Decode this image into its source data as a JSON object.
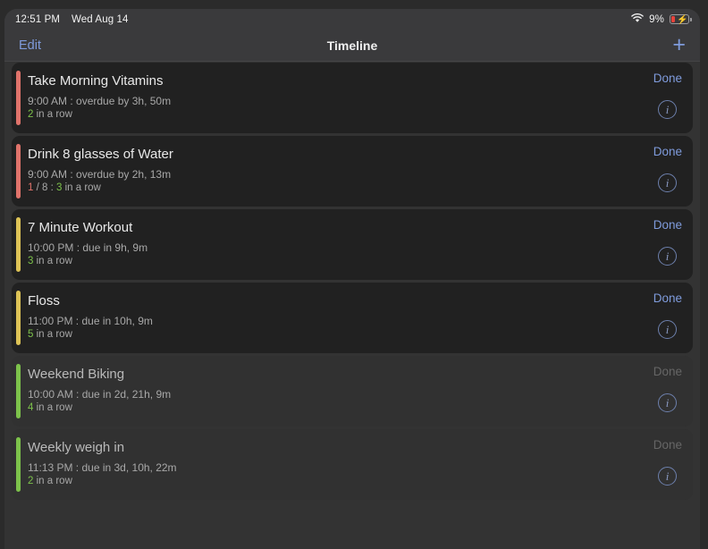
{
  "status_bar": {
    "time": "12:51 PM",
    "date": "Wed Aug 14",
    "wifi_icon": "wifi-icon",
    "battery_percent": "9%",
    "battery_icon": "battery-charging-icon"
  },
  "nav_bar": {
    "edit_label": "Edit",
    "title": "Timeline",
    "add_label": "+"
  },
  "colors": {
    "accent_blue": "#7f9bdc",
    "overdue_red": "#e0736b",
    "due_soon_yellow": "#ddc356",
    "upcoming_green": "#7dc24b",
    "streak_green": "#7dc24b",
    "disabled_gray": "#666666"
  },
  "tasks": [
    {
      "title": "Take Morning Vitamins",
      "schedule": "9:00 AM : overdue by 3h, 50m",
      "streak_count": "2",
      "streak_suffix": " in a row",
      "progress_current": "",
      "progress_rest": "",
      "accent_color": "#e0736b",
      "status": "overdue",
      "done_label": "Done",
      "done_enabled": true,
      "info_icon": "info-circle-icon"
    },
    {
      "title": "Drink 8 glasses of Water",
      "schedule": "9:00 AM : overdue by 2h, 13m",
      "streak_count": "3",
      "streak_suffix": " in a row",
      "progress_current": "1",
      "progress_rest": " / 8 : ",
      "accent_color": "#e0736b",
      "status": "overdue",
      "done_label": "Done",
      "done_enabled": true,
      "info_icon": "info-circle-icon"
    },
    {
      "title": "7 Minute Workout",
      "schedule": "10:00 PM : due in 9h, 9m",
      "streak_count": "3",
      "streak_suffix": " in a row",
      "progress_current": "",
      "progress_rest": "",
      "accent_color": "#ddc356",
      "status": "due-today",
      "done_label": "Done",
      "done_enabled": true,
      "info_icon": "info-circle-icon"
    },
    {
      "title": "Floss",
      "schedule": "11:00 PM : due in 10h, 9m",
      "streak_count": "5",
      "streak_suffix": " in a row",
      "progress_current": "",
      "progress_rest": "",
      "accent_color": "#ddc356",
      "status": "due-today",
      "done_label": "Done",
      "done_enabled": true,
      "info_icon": "info-circle-icon"
    },
    {
      "title": "Weekend Biking",
      "schedule": "10:00 AM : due in 2d, 21h, 9m",
      "streak_count": "4",
      "streak_suffix": " in a row",
      "progress_current": "",
      "progress_rest": "",
      "accent_color": "#7dc24b",
      "status": "upcoming",
      "done_label": "Done",
      "done_enabled": false,
      "info_icon": "info-circle-icon"
    },
    {
      "title": "Weekly weigh in",
      "schedule": "11:13 PM : due in 3d, 10h, 22m",
      "streak_count": "2",
      "streak_suffix": " in a row",
      "progress_current": "",
      "progress_rest": "",
      "accent_color": "#7dc24b",
      "status": "upcoming",
      "done_label": "Done",
      "done_enabled": false,
      "info_icon": "info-circle-icon"
    }
  ]
}
